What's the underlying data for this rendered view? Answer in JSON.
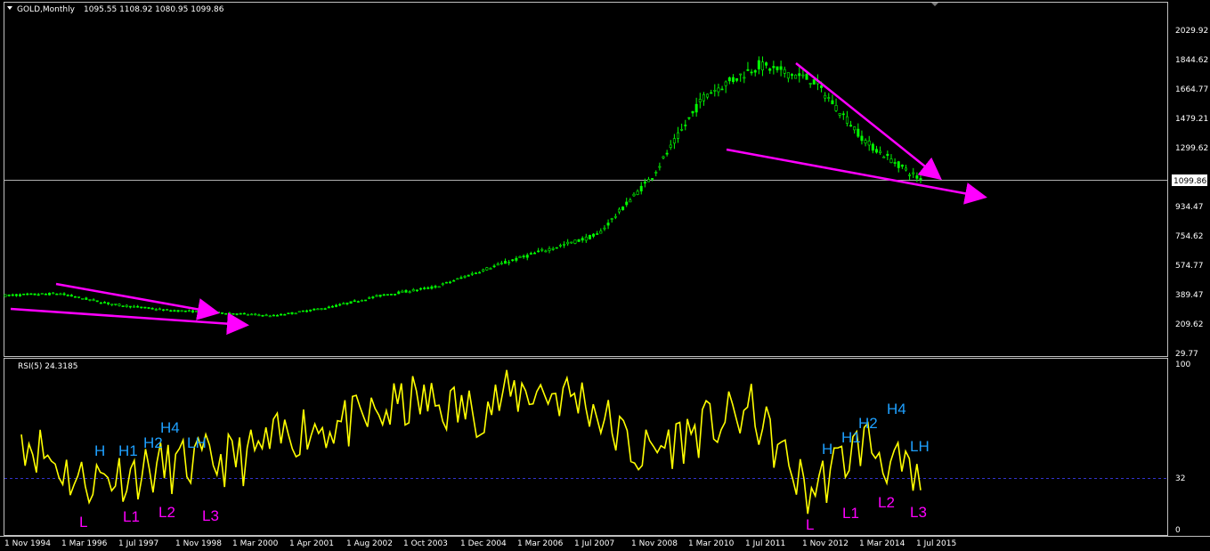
{
  "header": {
    "symbol": "GOLD,Monthly",
    "ohlc": "1095.55 1108.92 1080.95 1099.86"
  },
  "main_pane": {
    "price_ticks": [
      "2029.92",
      "1844.62",
      "1664.77",
      "1479.21",
      "1299.62",
      "1099.86",
      "934.47",
      "754.62",
      "574.77",
      "389.47",
      "209.62",
      "29.77"
    ],
    "current_price": "1099.86"
  },
  "rsi_pane": {
    "title": "RSI(5) 24.3185",
    "ticks": [
      "100",
      "32",
      "0"
    ]
  },
  "time_axis": [
    "1 Nov 1994",
    "1 Mar 1996",
    "1 Jul 1997",
    "1 Nov 1998",
    "1 Mar 2000",
    "1 Apr 2001",
    "1 Aug 2002",
    "1 Oct 2003",
    "1 Dec 2004",
    "1 Mar 2006",
    "1 Jul 2007",
    "1 Nov 2008",
    "1 Mar 2010",
    "1 Jul 2011",
    "1 Nov 2012",
    "1 Mar 2014",
    "1 Jul 2015"
  ],
  "colors": {
    "background": "#000000",
    "candles": "#00ff00",
    "rsi_line": "#ffff00",
    "trend_arrows": "#ff00ff",
    "label_high": "#1ea0ff",
    "label_low": "#ff00ff",
    "level_line": "#3333cc"
  },
  "annotations": {
    "left": {
      "H": "H",
      "H1": "H1",
      "H2": "H2",
      "H4": "H4",
      "LH": "LH",
      "L": "L",
      "L1": "L1",
      "L2": "L2",
      "L3": "L3"
    },
    "right": {
      "H": "H",
      "H1": "H1",
      "H2": "H2",
      "H4": "H4",
      "LH": "LH",
      "L": "L",
      "L1": "L1",
      "L2": "L2",
      "L3": "L3"
    }
  },
  "chart_data": [
    {
      "type": "line",
      "title": "GOLD,Monthly",
      "description_series": "Monthly close (approx.)",
      "x": [
        "1994-11",
        "1996-03",
        "1997-07",
        "1998-11",
        "2000-03",
        "2001-04",
        "2002-08",
        "2003-10",
        "2004-12",
        "2006-03",
        "2007-07",
        "2008-11",
        "2010-03",
        "2011-07",
        "2011-09",
        "2012-11",
        "2014-03",
        "2015-07"
      ],
      "series": [
        {
          "values": [
            384,
            396,
            330,
            294,
            279,
            260,
            310,
            386,
            438,
            560,
            665,
            760,
            1115,
            1630,
            1810,
            1720,
            1330,
            1100
          ]
        }
      ],
      "ylim": [
        29.77,
        2120
      ]
    },
    {
      "type": "line",
      "title": "RSI(5) 24.3185",
      "x": [
        "1994-11",
        "1996-03",
        "1997-07",
        "1998-11",
        "2000-03",
        "2001-04",
        "2002-08",
        "2003-10",
        "2004-12",
        "2006-03",
        "2007-07",
        "2008-11",
        "2010-03",
        "2011-07",
        "2012-11",
        "2014-03",
        "2015-07"
      ],
      "series": [
        {
          "values": [
            58,
            30,
            35,
            40,
            44,
            62,
            65,
            78,
            72,
            85,
            80,
            45,
            60,
            72,
            22,
            55,
            24.3185
          ]
        }
      ],
      "ylim": [
        0,
        100
      ],
      "levels": [
        32
      ]
    }
  ]
}
